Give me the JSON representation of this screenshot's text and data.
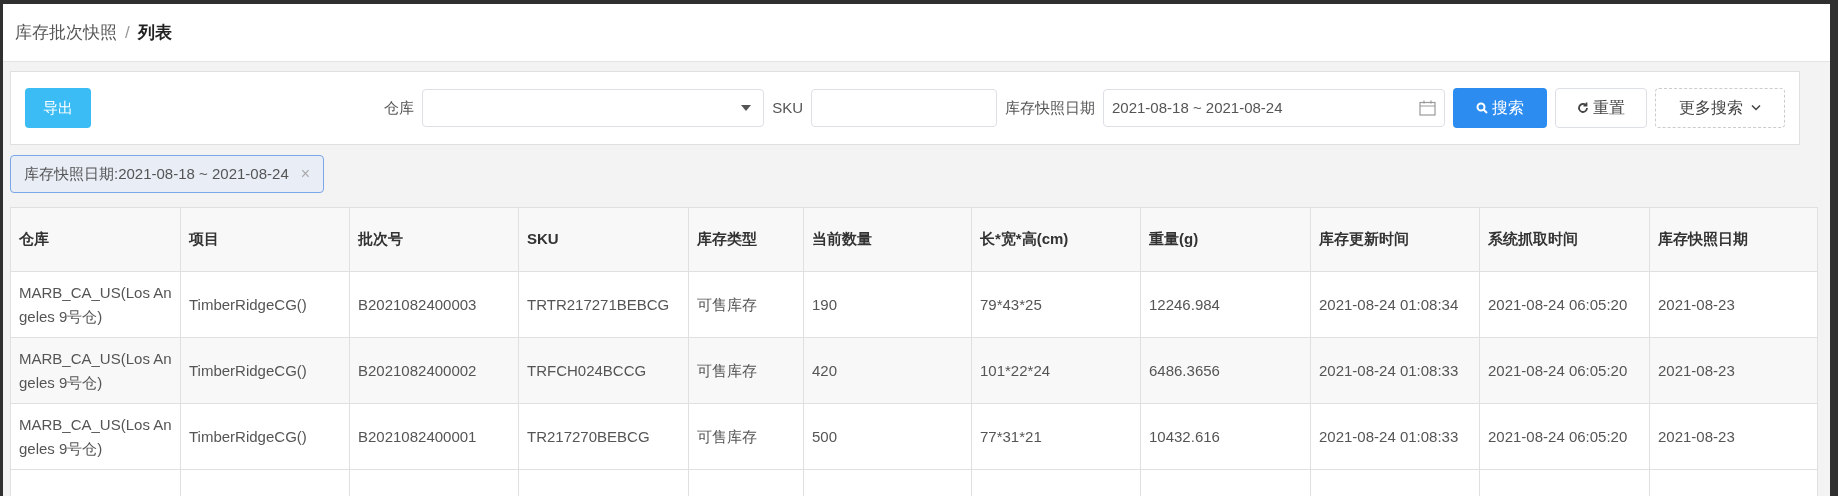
{
  "breadcrumb": {
    "parent": "库存批次快照",
    "separator": "/",
    "current": "列表"
  },
  "toolbar": {
    "export_button": "导出",
    "filters": [
      {
        "kind": "select",
        "label": "仓库"
      },
      {
        "kind": "input",
        "label": "SKU"
      },
      {
        "kind": "date",
        "label": "库存快照日期",
        "value": "2021-08-18 ~ 2021-08-24"
      }
    ],
    "search_button": "搜索",
    "reset_button": "重置",
    "more_button": "更多搜索"
  },
  "active_filter_tag": {
    "label": "库存快照日期:2021-08-18 ~ 2021-08-24",
    "close": "×"
  },
  "table": {
    "columns": [
      "仓库",
      "项目",
      "批次号",
      "SKU",
      "库存类型",
      "当前数量",
      "长*宽*高(cm)",
      "重量(g)",
      "库存更新时间",
      "系统抓取时间",
      "库存快照日期"
    ],
    "rows": [
      [
        "MARB_CA_US(Los Angeles 9号仓)",
        "TimberRidgeCG()",
        "B2021082400003",
        "TRTR217271BEBCG",
        "可售库存",
        "190",
        "79*43*25",
        "12246.984",
        "2021-08-24 01:08:34",
        "2021-08-24 06:05:20",
        "2021-08-23"
      ],
      [
        "MARB_CA_US(Los Angeles 9号仓)",
        "TimberRidgeCG()",
        "B2021082400002",
        "TRFCH024BCCG",
        "可售库存",
        "420",
        "101*22*24",
        "6486.3656",
        "2021-08-24 01:08:33",
        "2021-08-24 06:05:20",
        "2021-08-23"
      ],
      [
        "MARB_CA_US(Los Angeles 9号仓)",
        "TimberRidgeCG()",
        "B2021082400001",
        "TR217270BEBCG",
        "可售库存",
        "500",
        "77*31*21",
        "10432.616",
        "2021-08-24 01:08:33",
        "2021-08-24 06:05:20",
        "2021-08-23"
      ]
    ]
  }
}
